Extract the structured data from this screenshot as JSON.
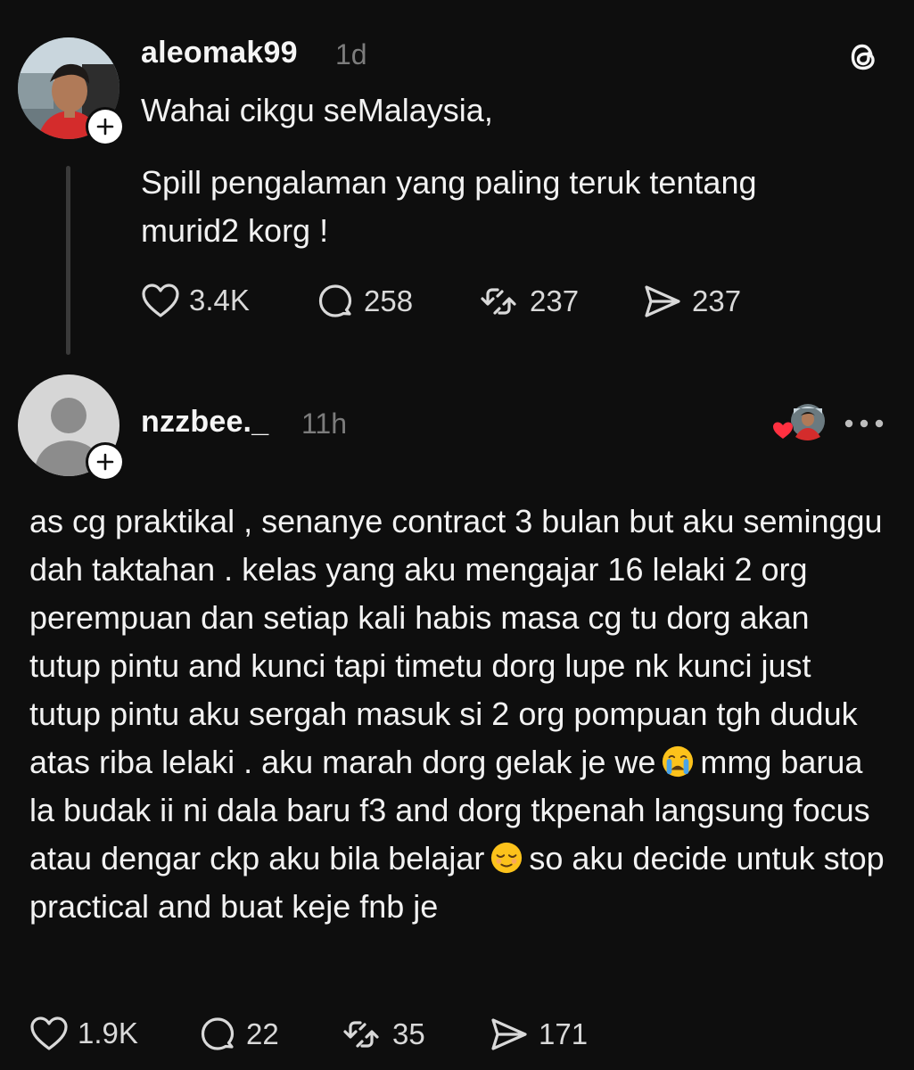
{
  "original_post": {
    "username": "aleomak99",
    "time": "1d",
    "lines": [
      "Wahai cikgu seMalaysia,",
      "Spill pengalaman yang paling teruk tentang",
      "murid2 korg !"
    ],
    "likes": "3.4K",
    "replies": "258",
    "reposts": "237",
    "shares": "237"
  },
  "reply_post": {
    "username": "nzzbee._",
    "time": "11h",
    "text_part1": "as cg praktikal , senanye contract 3 bulan but aku seminggu dah taktahan . kelas yang aku mengajar 16 lelaki 2 org perempuan dan setiap kali habis masa cg tu dorg akan tutup pintu and kunci tapi timetu dorg lupe nk kunci just tutup pintu aku sergah masuk si 2 org pompuan tgh duduk atas riba lelaki . aku marah dorg gelak je we",
    "text_part2": "mmg barua la budak ii ni dala baru f3 and dorg tkpenah langsung focus atau dengar ckp aku bila belajar",
    "text_part3": "so aku decide untuk stop practical and buat keje fnb je",
    "likes": "1.9K",
    "replies": "22",
    "reposts": "35",
    "shares": "171"
  },
  "icons": {
    "app_logo": "threads-logo-icon",
    "like": "heart-icon",
    "reply": "comment-icon",
    "repost": "repost-icon",
    "share": "send-icon",
    "more": "more-icon",
    "emoji_1": "crying-face-emoji",
    "emoji_2": "relieved-face-emoji"
  },
  "colors": {
    "background": "#0e0e0e",
    "text": "#f2f2f2",
    "muted": "#7c7c7c",
    "like_red": "#ff3040"
  }
}
